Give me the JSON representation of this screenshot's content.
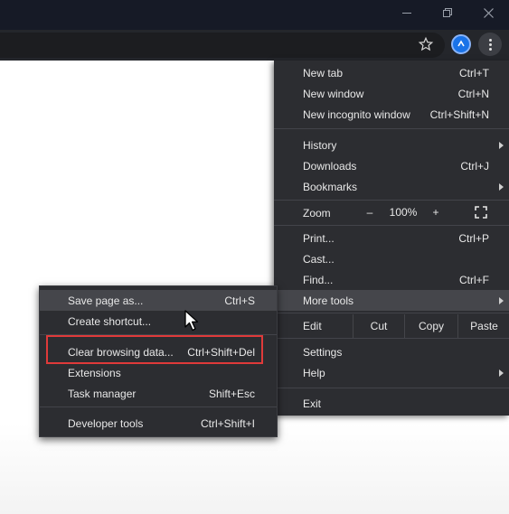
{
  "menu": {
    "items": [
      {
        "label": "New tab",
        "shortcut": "Ctrl+T"
      },
      {
        "label": "New window",
        "shortcut": "Ctrl+N"
      },
      {
        "label": "New incognito window",
        "shortcut": "Ctrl+Shift+N"
      },
      {
        "label": "History",
        "shortcut": ""
      },
      {
        "label": "Downloads",
        "shortcut": "Ctrl+J"
      },
      {
        "label": "Bookmarks",
        "shortcut": ""
      },
      {
        "label": "Print...",
        "shortcut": "Ctrl+P"
      },
      {
        "label": "Cast...",
        "shortcut": ""
      },
      {
        "label": "Find...",
        "shortcut": "Ctrl+F"
      },
      {
        "label": "More tools",
        "shortcut": ""
      },
      {
        "label": "Settings",
        "shortcut": ""
      },
      {
        "label": "Help",
        "shortcut": ""
      },
      {
        "label": "Exit",
        "shortcut": ""
      }
    ],
    "zoom": {
      "label": "Zoom",
      "minus": "–",
      "value": "100%",
      "plus": "+"
    },
    "edit": {
      "label": "Edit",
      "cut": "Cut",
      "copy": "Copy",
      "paste": "Paste"
    }
  },
  "submenu": {
    "items": [
      {
        "label": "Save page as...",
        "shortcut": "Ctrl+S"
      },
      {
        "label": "Create shortcut...",
        "shortcut": ""
      },
      {
        "label": "Clear browsing data...",
        "shortcut": "Ctrl+Shift+Del"
      },
      {
        "label": "Extensions",
        "shortcut": ""
      },
      {
        "label": "Task manager",
        "shortcut": "Shift+Esc"
      },
      {
        "label": "Developer tools",
        "shortcut": "Ctrl+Shift+I"
      }
    ]
  },
  "icons": {
    "bookmark_star": "star-icon",
    "extension": "extension-icon",
    "kebab": "more-vert-icon",
    "fullscreen": "fullscreen-icon",
    "minimize": "minimize-icon",
    "restore": "restore-icon",
    "close": "close-icon"
  },
  "colors": {
    "titlebar": "#161a26",
    "toolbar": "#24262b",
    "menu_bg": "#2c2d31",
    "highlight": "#45464b",
    "annotation_box": "#e03a3a",
    "extension_blue": "#1a73e8"
  }
}
